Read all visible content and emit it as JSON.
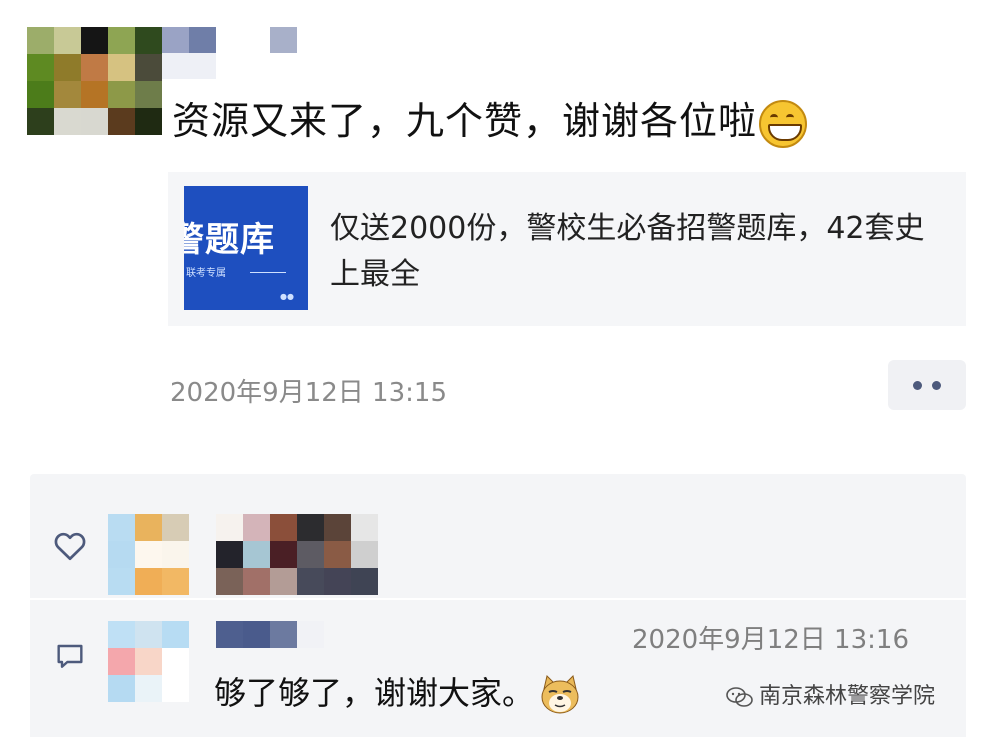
{
  "post": {
    "text": "资源又来了，九个赞，谢谢各位啦",
    "emoji": "grinning-face",
    "link_card": {
      "thumbnail_title": "警题库",
      "thumbnail_subtitle": "联考专属",
      "title": "仅送2000份，警校生必备招警题库，42套史上最全"
    },
    "timestamp": "2020年9月12日 13:15"
  },
  "more_button": {
    "icon": "more-dots-icon"
  },
  "likes": {
    "icon": "heart-icon"
  },
  "comment": {
    "icon": "comment-icon",
    "timestamp": "2020年9月12日 13:16",
    "text": "够了够了，谢谢大家。",
    "emoji": "doge-face"
  },
  "watermark": {
    "text": "南京森林警察学院"
  },
  "colors": {
    "link_card_bg": "#f5f6f8",
    "panel_bg": "#f4f5f7",
    "thumbnail_bg": "#1e4fbf",
    "timestamp": "#8a8a8a",
    "more_dots": "#4d5a7c"
  }
}
